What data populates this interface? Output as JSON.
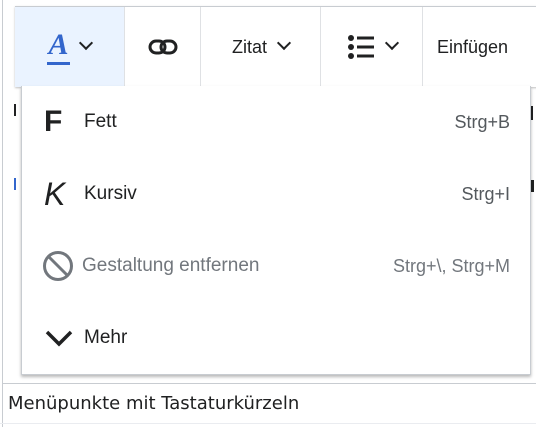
{
  "toolbar": {
    "style_icon": "text-style-icon",
    "style_glyph": "A",
    "link_icon": "link-icon",
    "cite_label": "Zitat",
    "list_icon": "bullet-list-icon",
    "insert_label": "Einfügen"
  },
  "menu": {
    "items": [
      {
        "icon": "bold-icon",
        "glyph": "F",
        "label": "Fett",
        "shortcut": "Strg+B",
        "disabled": false
      },
      {
        "icon": "italic-icon",
        "glyph": "K",
        "label": "Kursiv",
        "shortcut": "Strg+I",
        "disabled": false
      },
      {
        "icon": "clear-formatting-icon",
        "label": "Gestaltung entfernen",
        "shortcut": "Strg+\\, Strg+M",
        "disabled": true
      },
      {
        "icon": "chevron-down-icon",
        "label": "Mehr",
        "shortcut": "",
        "disabled": false
      }
    ]
  },
  "caption": "Menüpunkte mit Tastaturkürzeln",
  "colors": {
    "accent": "#3366cc",
    "active_button_bg": "#eaf3ff",
    "text": "#202122",
    "disabled_text": "#72777d",
    "border": "#c8ccd1"
  }
}
